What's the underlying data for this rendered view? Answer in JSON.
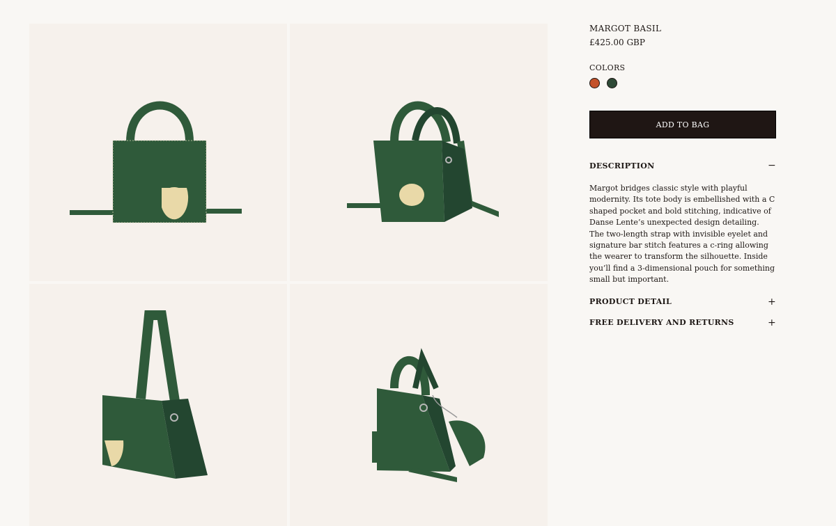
{
  "product": {
    "name": "MARGOT BASIL",
    "price": "£425.00 GBP"
  },
  "colors": {
    "label": "COLORS",
    "options": [
      {
        "name": "rust",
        "hex": "#c4522a"
      },
      {
        "name": "basil",
        "hex": "#2e4a36"
      }
    ]
  },
  "actions": {
    "add_to_bag": "ADD TO BAG"
  },
  "accordion": {
    "description": {
      "title": "DESCRIPTION",
      "toggle": "−",
      "body": "Margot bridges classic style with playful modernity. Its tote body is embellished with a C shaped pocket and bold stitching, indicative of Danse Lente’s unexpected design detailing. The two-length strap with invisible eyelet and signature bar stitch features a c-ring allowing the wearer to transform the silhouette. Inside you’ll find a 3-dimensional pouch for something small but important."
    },
    "product_detail": {
      "title": "PRODUCT DETAIL",
      "toggle": "+"
    },
    "delivery": {
      "title": "FREE DELIVERY AND RETURNS",
      "toggle": "+"
    }
  },
  "colors_theme": {
    "bag_green": "#2f5a3a",
    "bag_green_dark": "#234630",
    "pocket": "#e9d9a8",
    "background": "#f6f1ec",
    "button": "#1f1614"
  }
}
